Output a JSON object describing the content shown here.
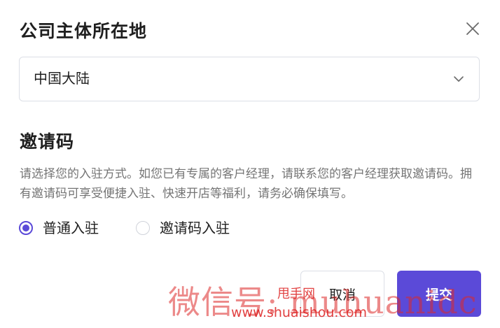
{
  "dialog": {
    "title": "公司主体所在地",
    "close_icon": "close-icon"
  },
  "region_select": {
    "value": "中国大陆",
    "chevron_icon": "chevron-down-icon"
  },
  "invite": {
    "title": "邀请码",
    "description": "请选择您的入驻方式。如您已有专属的客户经理，请联系您的客户经理获取邀请码。拥有邀请码可享受便捷入驻、快速开店等福利，请务必确保填写。",
    "options": [
      {
        "label": "普通入驻",
        "checked": true
      },
      {
        "label": "邀请码入驻",
        "checked": false
      }
    ]
  },
  "footer": {
    "cancel_label": "取消",
    "submit_label": "提交"
  },
  "watermark": {
    "line1": "微信号: muhuanidc",
    "line2": "甩手网",
    "line3": "www.shuaishou.com"
  },
  "colors": {
    "accent": "#5b4ad8",
    "border": "#dcdfe6",
    "muted_text": "#757575",
    "watermark": "#dc2828"
  }
}
